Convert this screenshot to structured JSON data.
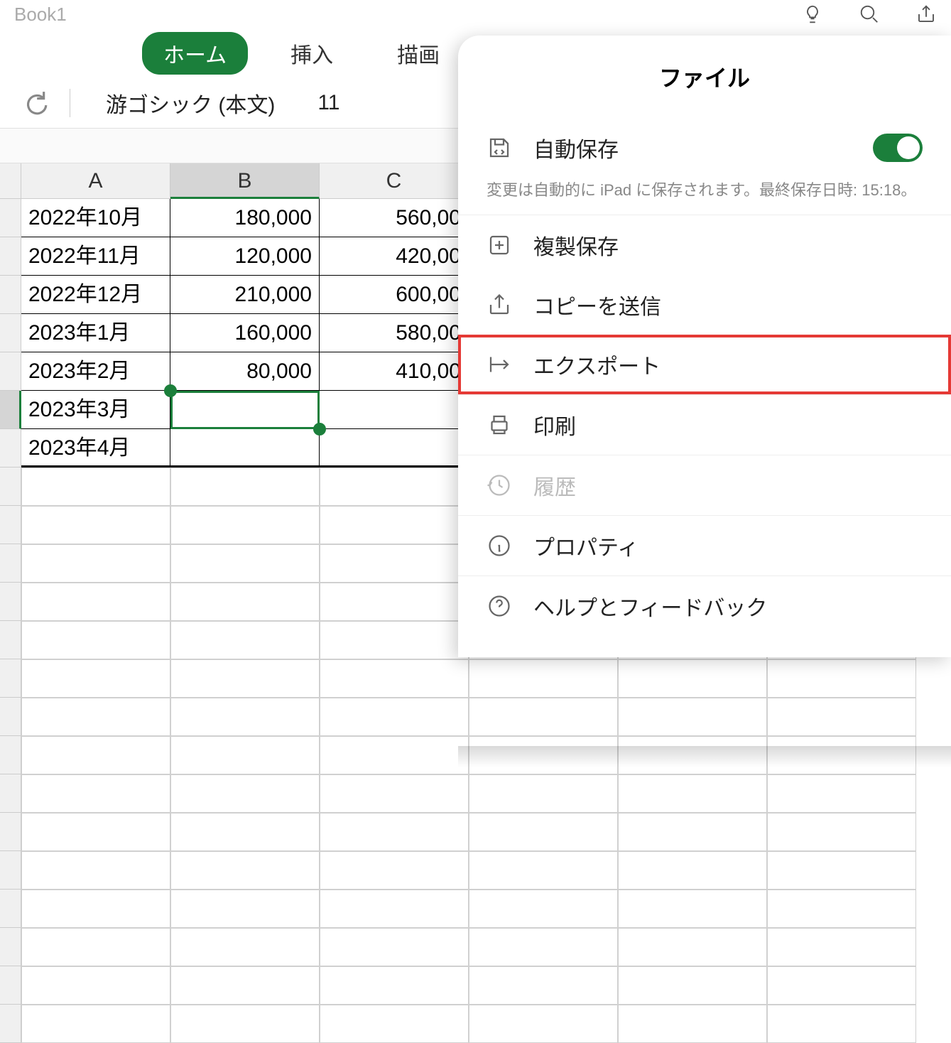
{
  "title": "Book1",
  "ribbon": {
    "tabs": {
      "home": "ホーム",
      "insert": "挿入",
      "draw": "描画"
    }
  },
  "format": {
    "font_name": "游ゴシック (本文)",
    "font_size": "11"
  },
  "columns": {
    "A": "A",
    "B": "B",
    "C": "C"
  },
  "rows": [
    {
      "a": "2022年10月",
      "b": "180,000",
      "c": "560,00"
    },
    {
      "a": "2022年11月",
      "b": "120,000",
      "c": "420,00"
    },
    {
      "a": "2022年12月",
      "b": "210,000",
      "c": "600,00"
    },
    {
      "a": "2023年1月",
      "b": "160,000",
      "c": "580,00"
    },
    {
      "a": "2023年2月",
      "b": "80,000",
      "c": "410,00"
    },
    {
      "a": "2023年3月",
      "b": "",
      "c": ""
    },
    {
      "a": "2023年4月",
      "b": "",
      "c": ""
    }
  ],
  "file_panel": {
    "title": "ファイル",
    "autosave": "自動保存",
    "autosave_note": "変更は自動的に iPad に保存されます。最終保存日時: 15:18。",
    "save_copy": "複製保存",
    "send_copy": "コピーを送信",
    "export": "エクスポート",
    "print": "印刷",
    "history": "履歴",
    "properties": "プロパティ",
    "help": "ヘルプとフィードバック"
  }
}
